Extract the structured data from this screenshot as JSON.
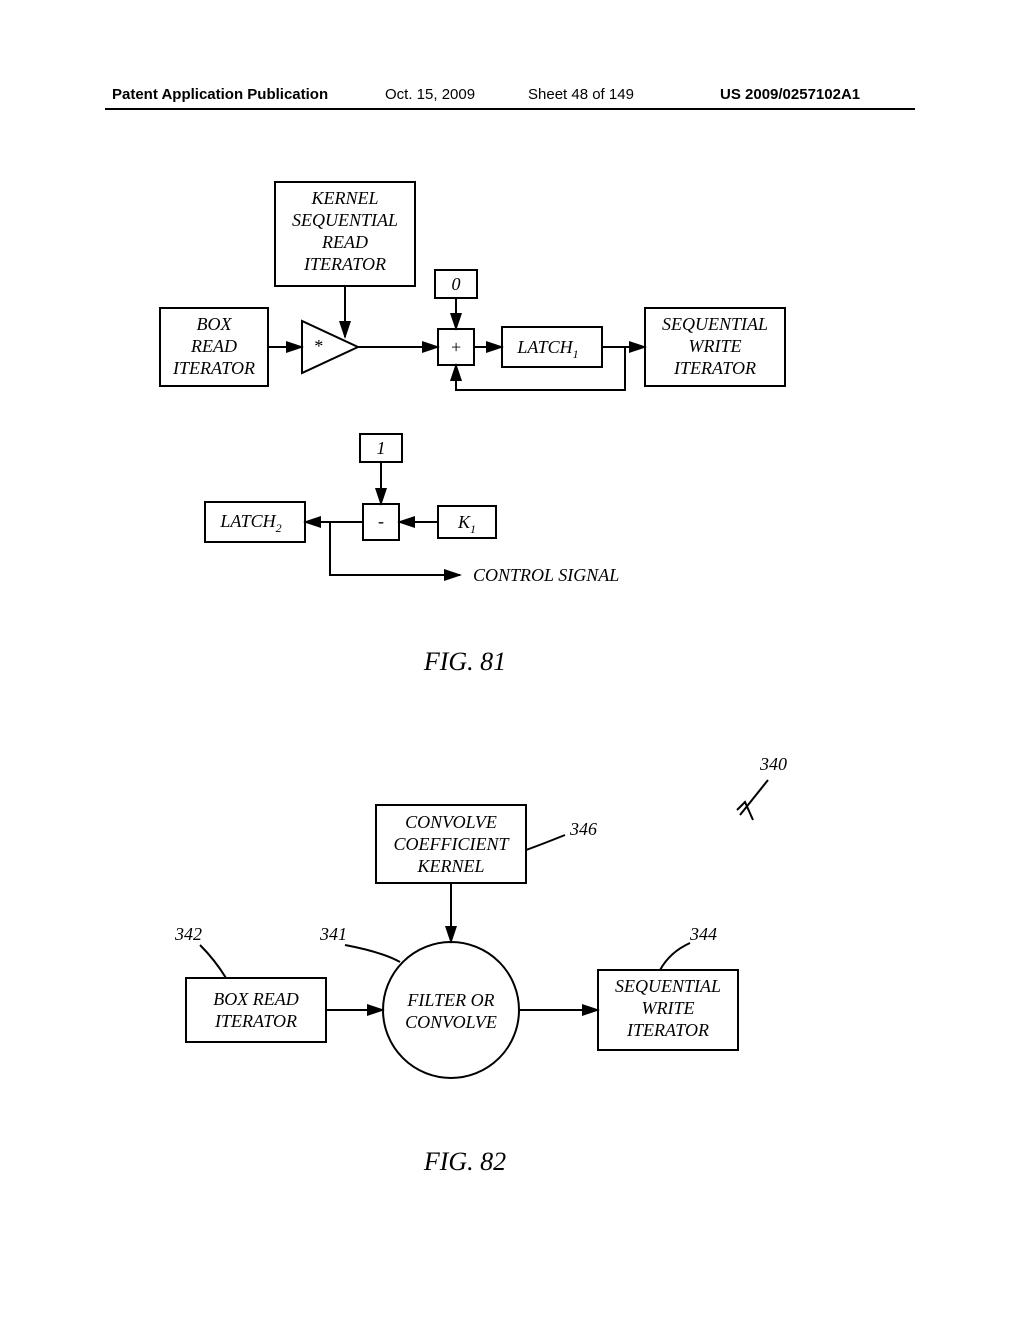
{
  "header": {
    "left": "Patent Application Publication",
    "date": "Oct. 15, 2009",
    "sheet": "Sheet 48 of 149",
    "pubno": "US 2009/0257102A1"
  },
  "fig81": {
    "box_read": "BOX\nREAD\nITERATOR",
    "kernel": "KERNEL\nSEQUENTIAL\nREAD\nITERATOR",
    "zero": "0",
    "mul": "*",
    "add": "+",
    "latch1": "LATCH",
    "latch1_sub": "1",
    "seq_write": "SEQUENTIAL\nWRITE\nITERATOR",
    "latch2": "LATCH",
    "latch2_sub": "2",
    "one": "1",
    "sub": "-",
    "k1": "K",
    "k1_sub": "1",
    "control": "CONTROL SIGNAL",
    "caption": "FIG. 81"
  },
  "fig82": {
    "kernel": "CONVOLVE\nCOEFFICIENT\nKERNEL",
    "box_read": "BOX READ\nITERATOR",
    "circle": "FILTER OR\nCONVOLVE",
    "seq_write": "SEQUENTIAL\nWRITE\nITERATOR",
    "ref340": "340",
    "ref346": "346",
    "ref342": "342",
    "ref341": "341",
    "ref344": "344",
    "caption": "FIG. 82"
  }
}
